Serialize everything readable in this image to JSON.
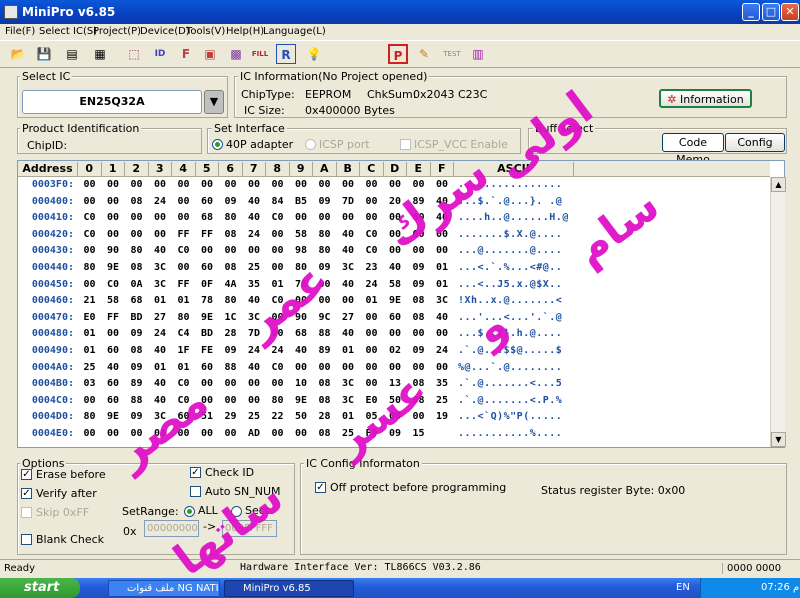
{
  "window": {
    "title": "MiniPro v6.85"
  },
  "menu": [
    "File(F)",
    "Select IC(S)",
    "Project(P)",
    "Device(D)",
    "Tools(V)",
    "Help(H)",
    "Language(L)"
  ],
  "select_ic": {
    "label": "Select IC",
    "value": "EN25Q32A"
  },
  "ic_info": {
    "label": "IC Information(No Project opened)",
    "chip_type_label": "ChipType:",
    "chip_type": "EEPROM",
    "chksum_label": "ChkSum:",
    "chksum": "0x2043 C23C",
    "ic_size_label": "IC Size:",
    "ic_size": "0x400000 Bytes",
    "info_button": "Information"
  },
  "product_id": {
    "label": "Product Identification",
    "chip_id_label": "ChipID:"
  },
  "interface": {
    "label": "Set Interface",
    "opt1": "40P adapter",
    "opt2": "ICSP port",
    "opt3": "ICSP_VCC Enable"
  },
  "buff": {
    "label": "Buff select",
    "code_memo": "Code Memo",
    "config": "Config"
  },
  "grid": {
    "headers": [
      "Address",
      "0",
      "1",
      "2",
      "3",
      "4",
      "5",
      "6",
      "7",
      "8",
      "9",
      "A",
      "B",
      "C",
      "D",
      "E",
      "F",
      "ASCII"
    ],
    "rows": [
      {
        "addr": "0003F0:",
        "cells": [
          "00",
          "00",
          "00",
          "00",
          "00",
          "00",
          "00",
          "00",
          "00",
          "00",
          "00",
          "00",
          "00",
          "00",
          "00",
          "00"
        ],
        "ascii": "................"
      },
      {
        "addr": "000400:",
        "cells": [
          "00",
          "00",
          "08",
          "24",
          "00",
          "60",
          "09",
          "40",
          "84",
          "B5",
          "09",
          "7D",
          "00",
          "20",
          "89",
          "40"
        ],
        "ascii": "...$.`.@...}. .@"
      },
      {
        "addr": "000410:",
        "cells": [
          "C0",
          "00",
          "00",
          "00",
          "00",
          "68",
          "80",
          "40",
          "C0",
          "00",
          "00",
          "00",
          "00",
          "00",
          "80",
          "40"
        ],
        "ascii": "....h..@......H.@"
      },
      {
        "addr": "000420:",
        "cells": [
          "C0",
          "00",
          "00",
          "00",
          "FF",
          "FF",
          "08",
          "24",
          "00",
          "58",
          "80",
          "40",
          "C0",
          "00",
          "00",
          "00"
        ],
        "ascii": ".......$.X.@...."
      },
      {
        "addr": "000430:",
        "cells": [
          "00",
          "90",
          "80",
          "40",
          "C0",
          "00",
          "00",
          "00",
          "00",
          "98",
          "80",
          "40",
          "C0",
          "00",
          "00",
          "00"
        ],
        "ascii": "...@.......@...."
      },
      {
        "addr": "000440:",
        "cells": [
          "80",
          "9E",
          "08",
          "3C",
          "00",
          "60",
          "08",
          "25",
          "00",
          "80",
          "09",
          "3C",
          "23",
          "40",
          "09",
          "01"
        ],
        "ascii": "...<.`.%...<#@.."
      },
      {
        "addr": "000450:",
        "cells": [
          "00",
          "C0",
          "0A",
          "3C",
          "FF",
          "0F",
          "4A",
          "35",
          "01",
          "78",
          "00",
          "40",
          "24",
          "58",
          "09",
          "01"
        ],
        "ascii": "...<..J5.x.@$X.."
      },
      {
        "addr": "000460:",
        "cells": [
          "21",
          "58",
          "68",
          "01",
          "01",
          "78",
          "80",
          "40",
          "C0",
          "00",
          "00",
          "00",
          "01",
          "9E",
          "08",
          "3C"
        ],
        "ascii": "!Xh..x.@.......<"
      },
      {
        "addr": "000470:",
        "cells": [
          "E0",
          "FF",
          "BD",
          "27",
          "80",
          "9E",
          "1C",
          "3C",
          "00",
          "90",
          "9C",
          "27",
          "00",
          "60",
          "08",
          "40"
        ],
        "ascii": "...'...<...'.`.@"
      },
      {
        "addr": "000480:",
        "cells": [
          "01",
          "00",
          "09",
          "24",
          "C4",
          "BD",
          "28",
          "7D",
          "00",
          "68",
          "88",
          "40",
          "00",
          "00",
          "00",
          "00"
        ],
        "ascii": "...$..(}.h.@...."
      },
      {
        "addr": "000490:",
        "cells": [
          "01",
          "60",
          "08",
          "40",
          "1F",
          "FE",
          "09",
          "24",
          "24",
          "40",
          "89",
          "01",
          "00",
          "02",
          "09",
          "24"
        ],
        "ascii": ".`.@...$$@.....$"
      },
      {
        "addr": "0004A0:",
        "cells": [
          "25",
          "40",
          "09",
          "01",
          "01",
          "60",
          "88",
          "40",
          "C0",
          "00",
          "00",
          "00",
          "00",
          "00",
          "00",
          "00"
        ],
        "ascii": "%@...`.@........"
      },
      {
        "addr": "0004B0:",
        "cells": [
          "03",
          "60",
          "89",
          "40",
          "C0",
          "00",
          "00",
          "00",
          "00",
          "10",
          "08",
          "3C",
          "00",
          "13",
          "08",
          "35"
        ],
        "ascii": ".`.@.......<...5"
      },
      {
        "addr": "0004C0:",
        "cells": [
          "00",
          "60",
          "88",
          "40",
          "C0",
          "00",
          "00",
          "00",
          "80",
          "9E",
          "08",
          "3C",
          "E0",
          "50",
          "08",
          "25"
        ],
        "ascii": ".`.@.......<.P.%"
      },
      {
        "addr": "0004D0:",
        "cells": [
          "80",
          "9E",
          "09",
          "3C",
          "60",
          "51",
          "29",
          "25",
          "22",
          "50",
          "28",
          "01",
          "05",
          "00",
          "00",
          "19"
        ],
        "ascii": "...<`Q)%\"P(....."
      },
      {
        "addr": "0004E0:",
        "cells": [
          "00",
          "00",
          "00",
          "00",
          "00",
          "00",
          "00",
          "AD",
          "00",
          "00",
          "08",
          "25",
          "F0",
          "09",
          "15",
          ""
        ],
        "ascii": "...........%...."
      }
    ]
  },
  "options": {
    "label": "Options",
    "erase": "Erase before",
    "verify": "Verify after",
    "skip": "Skip 0xFF",
    "blank": "Blank Check",
    "check_id": "Check ID",
    "auto_sn": "Auto SN_NUM",
    "set_range": "SetRange:",
    "all": "ALL",
    "sect": "Sect",
    "ox": "0x",
    "range_from": "00000000",
    "arrow": "->",
    "range_to": "003FFFFF"
  },
  "ic_config": {
    "label": "IC Config Informaton",
    "write_protect": "Off protect before programming",
    "status_register": "Status register Byte: 0x00"
  },
  "status": {
    "left": "Ready",
    "hardware": "Hardware Interface Ver: TL866CS V03.2.86",
    "right": "0000 0000"
  },
  "taskbar": {
    "start": "start",
    "task1": "ملف قنوات NG NATIO...",
    "task2": "MiniPro v6.85",
    "lang": "EN",
    "time": "07:26 م"
  },
  "watermark": {
    "line1": "مصر",
    "line2": "عمر",
    "line3": "سرك",
    "line4": "اولى",
    "line5": "ساتها",
    "line6": "عسر",
    "line7": "و",
    "line8": "سام"
  }
}
